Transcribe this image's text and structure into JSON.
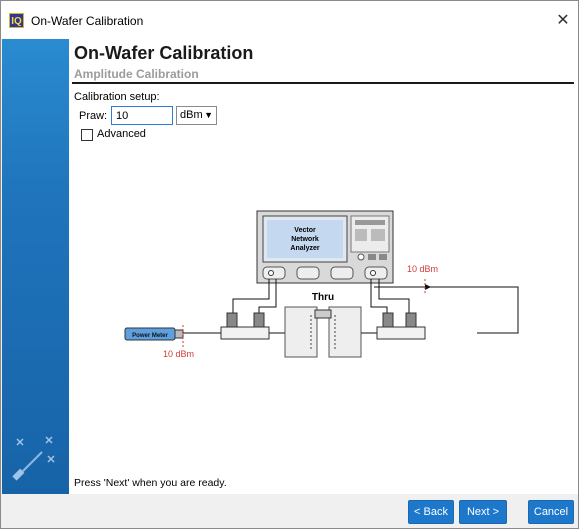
{
  "window": {
    "title": "On-Wafer Calibration",
    "app_icon_text": "IQ"
  },
  "header": {
    "title": "On-Wafer Calibration",
    "subtitle": "Amplitude Calibration"
  },
  "setup": {
    "label": "Calibration setup:",
    "praw_label": "Praw:",
    "praw_value": "10",
    "unit_selected": "dBm",
    "advanced_label": "Advanced",
    "advanced_checked": false
  },
  "diagram": {
    "vna_label_line1": "Vector",
    "vna_label_line2": "Network",
    "vna_label_line3": "Analyzer",
    "thru_label": "Thru",
    "power_meter_label": "Power Meter",
    "level_right": "10 dBm",
    "level_left": "10 dBm"
  },
  "footer": {
    "instruction": "Press 'Next' when you are ready."
  },
  "buttons": {
    "back": "< Back",
    "next": "Next >",
    "cancel": "Cancel"
  },
  "colors": {
    "accent": "#1d78cc",
    "side_panel": "#1f74bb",
    "annotation": "#d33a3a"
  }
}
